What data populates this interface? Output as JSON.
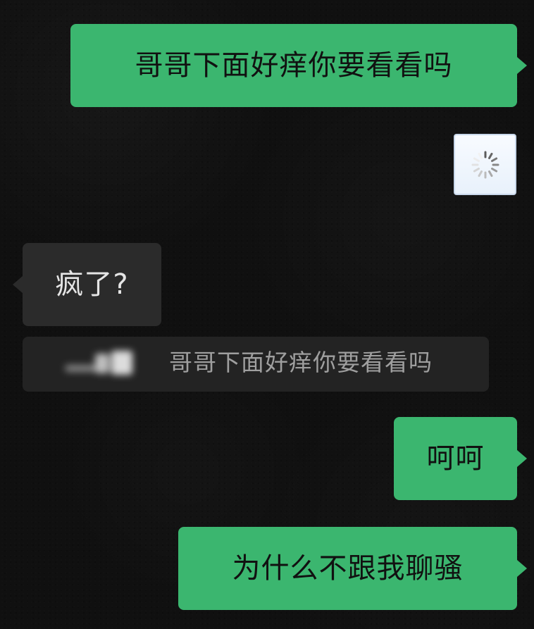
{
  "conversation": {
    "messages": [
      {
        "text": "哥哥下面好痒你要看看吗"
      },
      {
        "text": "疯了?"
      },
      {
        "text": "呵呵"
      },
      {
        "text": "为什么不跟我聊骚"
      }
    ],
    "quoted_reply": {
      "text": "哥哥下面好痒你要看看吗"
    }
  },
  "colors": {
    "outgoing_bubble": "#3bb66f",
    "incoming_bubble": "#2b2b2b",
    "reply_quote_bg": "#232323",
    "text_dark": "#111111",
    "text_light": "#e5e5e5",
    "text_muted": "#9f9f9f",
    "background": "#101010"
  },
  "icons": {
    "loading": "loading-spinner-icon",
    "thumbnail": "blurred-image-thumbnail"
  }
}
